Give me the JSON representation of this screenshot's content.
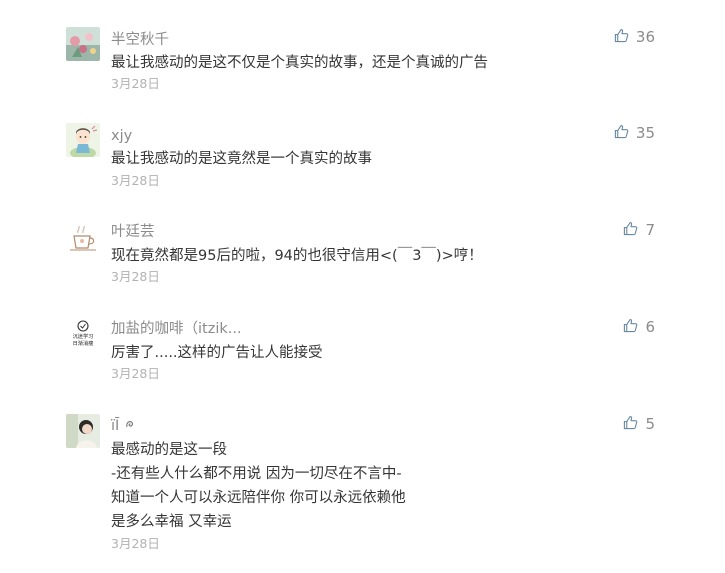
{
  "comments": [
    {
      "nickname": "半空秋千",
      "avatar": "avatar-flower",
      "lines": [
        "最让我感动的是这不仅是个真实的故事，还是个真诚的广告"
      ],
      "date": "3月28日",
      "likes": "36"
    },
    {
      "nickname": "xjy",
      "avatar": "avatar-cartoon-girl",
      "lines": [
        "最让我感动的是这竟然是一个真实的故事"
      ],
      "date": "3月28日",
      "likes": "35"
    },
    {
      "nickname": "叶廷芸",
      "avatar": "avatar-cup-sketch",
      "lines": [
        "现在竟然都是95后的啦，94的也很守信用<(￣3￣)>哼！"
      ],
      "date": "3月28日",
      "likes": "7"
    },
    {
      "nickname": "加盐的咖啡（itzik...",
      "avatar": "avatar-logo",
      "avatar_text": [
        "沉迷学习",
        "日渐消瘦"
      ],
      "lines": [
        "厉害了.....这样的广告让人能接受"
      ],
      "date": "3月28日",
      "likes": "6"
    },
    {
      "nickname": "ïĪ",
      "avatar": "avatar-person",
      "lines": [
        "最感动的是这一段",
        "-还有些人什么都不用说 因为一切尽在不言中-",
        "知道一个人可以永远陪伴你 你可以永远依赖他",
        "是多么幸福 又幸运"
      ],
      "date": "3月28日",
      "likes": "5"
    }
  ],
  "icons": {
    "like": "thumbs-up-icon"
  },
  "colors": {
    "nickname": "#8b8b8b",
    "content": "#353535",
    "date": "#b2b2b2",
    "like_icon": "#6a8aa3"
  }
}
